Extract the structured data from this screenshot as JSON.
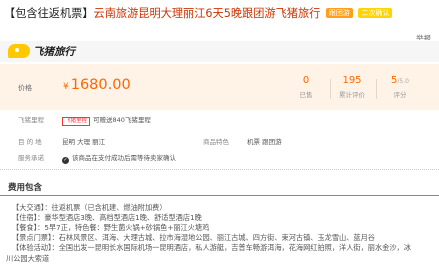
{
  "title": {
    "bracket": "【包含往返机票】",
    "text": "云南旅游昆明大理丽江6天5晚跟团游飞猪旅行",
    "tag1": "跟团游",
    "tag2": "二次确认"
  },
  "report_label": "举报",
  "logo": {
    "icon": "fliggy-pig-icon",
    "text": "飞猪旅行"
  },
  "price": {
    "label": "价格",
    "currency": "¥",
    "value": "1680.00",
    "stats": [
      {
        "value": "0",
        "label": "已售"
      },
      {
        "value": "195",
        "label": "累计评价"
      },
      {
        "value": "5",
        "suffix": "/5.0",
        "label": "评分"
      }
    ]
  },
  "promo": {
    "label": "飞猪里程",
    "tag": "飞猪里程",
    "text": "可赠送840飞猪里程"
  },
  "destination": {
    "label": "目 的 地",
    "value": "昆明  大理  丽江"
  },
  "feature": {
    "label": "商品特色",
    "value": "机票  跟团游"
  },
  "service": {
    "label": "服务承诺",
    "text": "该商品在支付成功后需等待卖家确认"
  },
  "fee": {
    "title": "费用包含",
    "lines": [
      "【大交通】：往返机票（已含机建、燃油附加费）",
      "【住宿】：豪华型酒店3晚、高档型酒店1晚、舒适型酒店1晚",
      "【餐食】：5早7正，特色餐：野生菌火锅+砂锅鱼+丽江火塘鸡",
      "【景点门票】：石林风景区、洱海、大理古城、拉市海湿地公园、丽江古城、四方街、束河古镇、玉龙雪山、蓝月谷",
      "【体验活动】：全国出发一昆明长水国际机场一昆明酒店，私人游艇，吉普车畅游洱海，花海网红拍照，洋人街，丽水金沙，冰",
      "川公园大索道"
    ]
  },
  "colors": {
    "accent": "#ff6600",
    "price_bg": "#fff3e8",
    "brand_yellow": "#ffc800"
  }
}
